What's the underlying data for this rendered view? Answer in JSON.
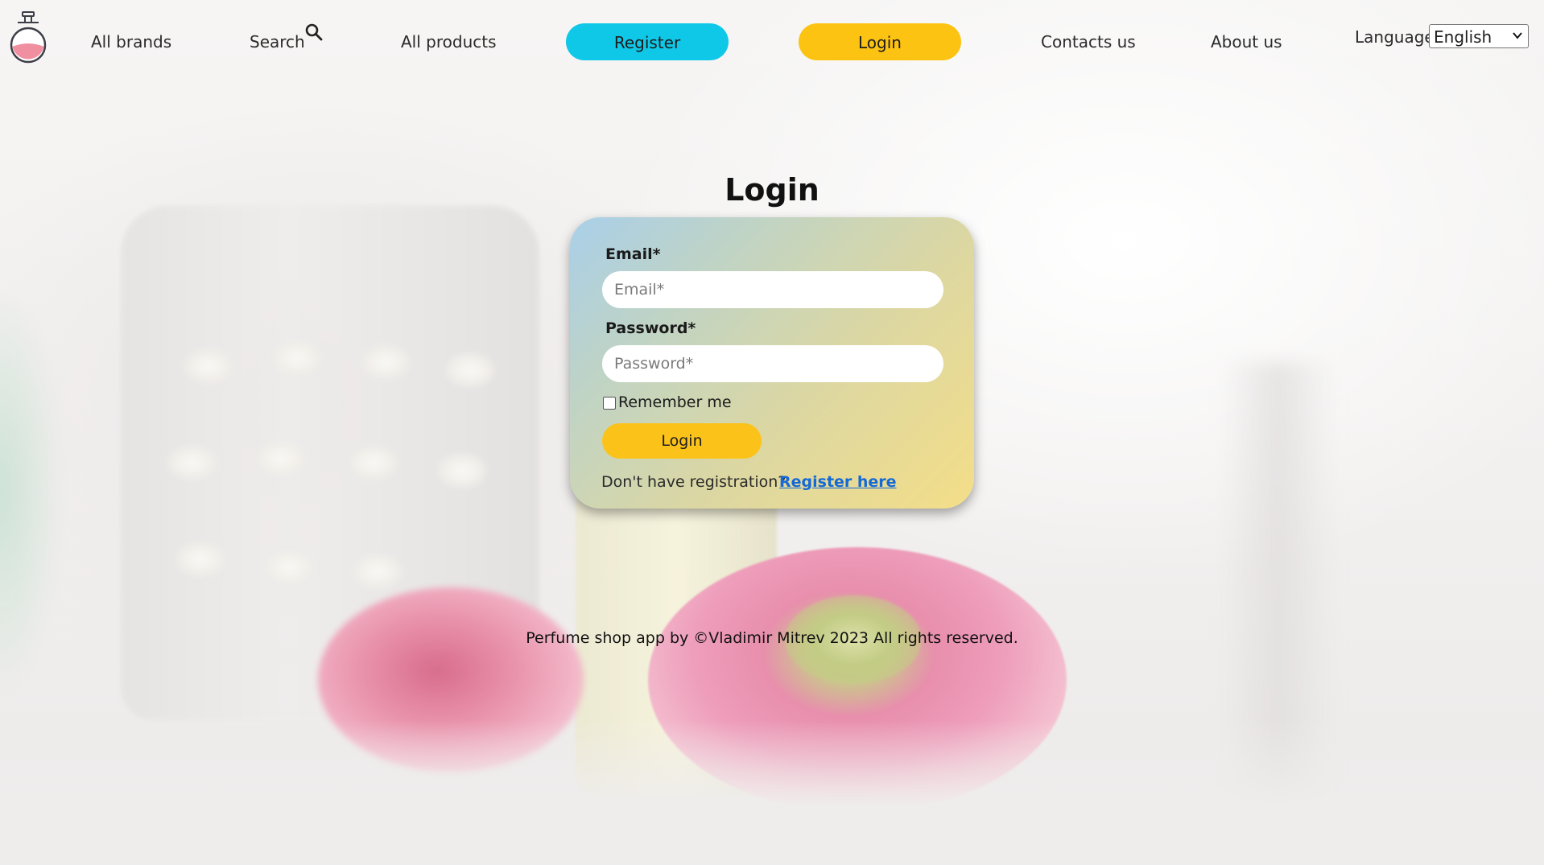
{
  "nav": {
    "all_brands": "All brands",
    "search": "Search",
    "all_products": "All products",
    "register": "Register",
    "login": "Login",
    "contacts": "Contacts us",
    "about": "About us",
    "language_label": "Language",
    "language_value": "English"
  },
  "login": {
    "title": "Login",
    "email_label": "Email*",
    "email_placeholder": "Email*",
    "password_label": "Password*",
    "password_placeholder": "Password*",
    "remember_me": "Remember me",
    "remember_checked": false,
    "submit": "Login",
    "no_registration": "Don't have registration?",
    "register_link": "Register here"
  },
  "footer": {
    "text": "Perfume shop app by ©Vladimir Mitrev 2023 All rights reserved."
  },
  "colors": {
    "register_pill": "#0fc8e8",
    "login_pill": "#fdc312",
    "link": "#1569d6"
  },
  "icons": {
    "logo": "perfume-bottle-icon",
    "search": "search-icon",
    "language_dropdown": "chevron-down-icon"
  }
}
